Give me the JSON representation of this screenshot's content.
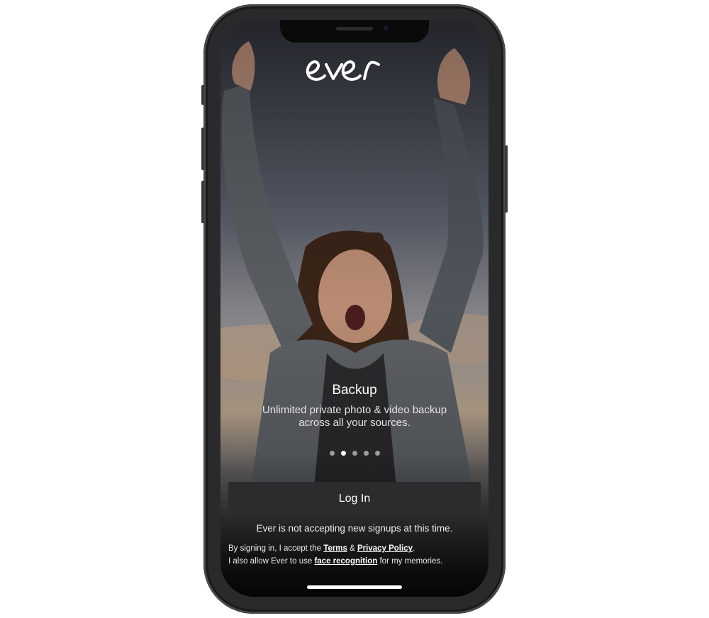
{
  "app": {
    "logo_text": "ever",
    "logo_icon": "ever-script-logo"
  },
  "onboarding": {
    "title": "Backup",
    "body": "Unlimited private photo & video backup across all your sources.",
    "page_count": 5,
    "active_page": 2
  },
  "login_button": {
    "label": "Log In"
  },
  "notice": "Ever is not accepting new signups at this time.",
  "legal": {
    "line1_prefix": "By signing in, I accept the ",
    "terms": "Terms",
    "and": " & ",
    "privacy": "Privacy Policy",
    "line1_suffix": ".",
    "line2_prefix": "I also allow Ever to use ",
    "face_recognition": "face recognition",
    "line2_suffix": " for my memories."
  },
  "colors": {
    "button_bg": "#2c2c2e",
    "text": "#ffffff",
    "dot_inactive": "rgba(255,255,255,0.55)"
  }
}
